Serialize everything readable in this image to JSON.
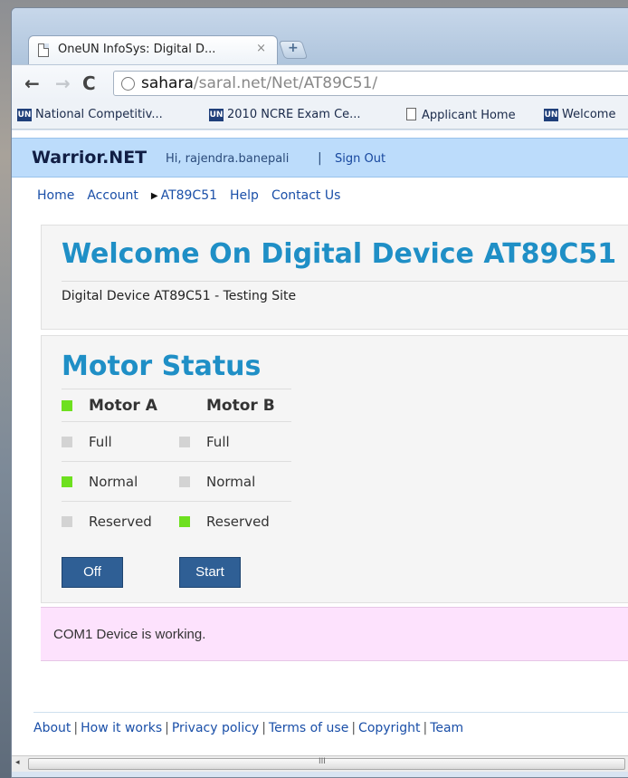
{
  "browser": {
    "tab": {
      "title": "OneUN InfoSys: Digital D...",
      "close": "×"
    },
    "nav": {
      "back": "←",
      "forward": "→",
      "reload": "C"
    },
    "address": {
      "host": "sahara",
      "path": "/saral.net/Net/AT89C51/"
    },
    "bookmarks": [
      {
        "icon": "UN",
        "label": "National Competitiv..."
      },
      {
        "icon": "UN",
        "label": "2010 NCRE Exam Ce..."
      },
      {
        "icon": "doc",
        "label": "Applicant Home"
      },
      {
        "icon": "UN",
        "label": "Welcome"
      }
    ]
  },
  "site": {
    "brand": "Warrior.NET",
    "greeting": "Hi, rajendra.banepali",
    "separator": "|",
    "signout": "Sign Out",
    "nav": [
      {
        "label": "Home"
      },
      {
        "label": "Account"
      },
      {
        "label": "AT89C51",
        "active": true
      },
      {
        "label": "Help"
      },
      {
        "label": "Contact Us"
      }
    ]
  },
  "welcome": {
    "title": "Welcome On Digital Device AT89C51",
    "subtitle": "Digital Device AT89C51 - Testing Site"
  },
  "motor": {
    "title": "Motor Status",
    "motor_a": "Motor A",
    "motor_b": "Motor B",
    "rows": [
      {
        "a_label": "Full",
        "b_label": "Full"
      },
      {
        "a_label": "Normal",
        "b_label": "Normal"
      },
      {
        "a_label": "Reserved",
        "b_label": "Reserved"
      }
    ],
    "colors": {
      "on": "#6ee01f",
      "off_head": "#e5120f",
      "idle": "#d3d3d3"
    },
    "states": {
      "motor_a_header": "on",
      "motor_b_header": "off",
      "a": [
        "idle",
        "on",
        "idle"
      ],
      "b": [
        "idle",
        "idle",
        "on"
      ]
    },
    "off_button": "Off",
    "start_button": "Start"
  },
  "status": {
    "message": "COM1 Device is working."
  },
  "footer": {
    "links": [
      "About",
      "How it works",
      "Privacy policy",
      "Terms of use",
      "Copyright",
      "Team"
    ],
    "sep": "|"
  },
  "scrollbar": {
    "left_arrow": "◂",
    "grip": "III"
  }
}
